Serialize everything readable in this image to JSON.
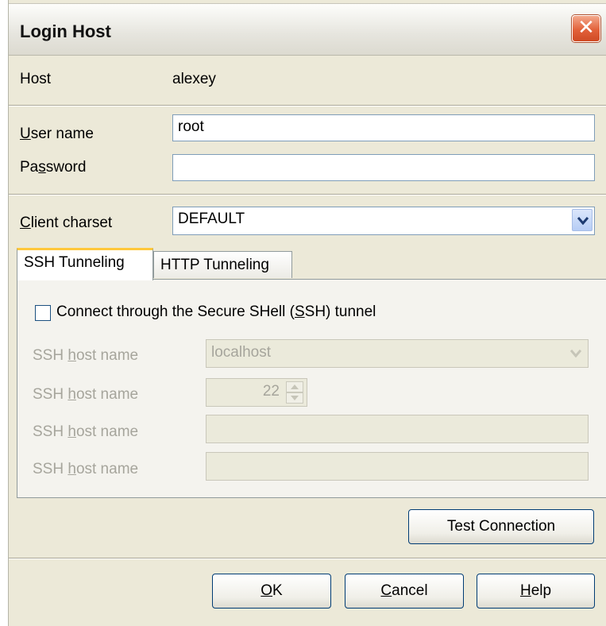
{
  "window": {
    "title": "Login Host"
  },
  "host": {
    "label": "Host",
    "value": "alexey"
  },
  "user": {
    "label_accel": "U",
    "label_rest": "ser name",
    "value": "root"
  },
  "password": {
    "label_pre": "Pa",
    "label_accel": "s",
    "label_rest": "sword",
    "value": ""
  },
  "charset": {
    "label_accel": "C",
    "label_rest": "lient charset",
    "value": "DEFAULT"
  },
  "tabs": [
    {
      "label": "SSH Tunneling",
      "active": true
    },
    {
      "label": "HTTP Tunneling",
      "active": false
    }
  ],
  "ssh": {
    "checkbox_pre": "Connect through the Secure SHell (",
    "checkbox_accel": "S",
    "checkbox_rest": "SH) tunnel",
    "checked": false,
    "rows": [
      {
        "label_pre": "SSH ",
        "label_accel": "h",
        "label_rest": "ost name",
        "value": "localhost"
      },
      {
        "label_pre": "SSH ",
        "label_accel": "h",
        "label_rest": "ost name",
        "value": "22"
      },
      {
        "label_pre": "SSH ",
        "label_accel": "h",
        "label_rest": "ost name",
        "value": ""
      },
      {
        "label_pre": "SSH ",
        "label_accel": "h",
        "label_rest": "ost name",
        "value": ""
      }
    ]
  },
  "buttons": {
    "test": "Test Connection",
    "ok_accel": "O",
    "ok_rest": "K",
    "cancel_accel": "C",
    "cancel_rest": "ancel",
    "help_accel": "H",
    "help_rest": "elp"
  },
  "colors": {
    "titlebar": "#e6e5de",
    "close": "#e2613a",
    "dialog_bg": "#ece9d8",
    "tab_highlight": "#ffc83c"
  }
}
